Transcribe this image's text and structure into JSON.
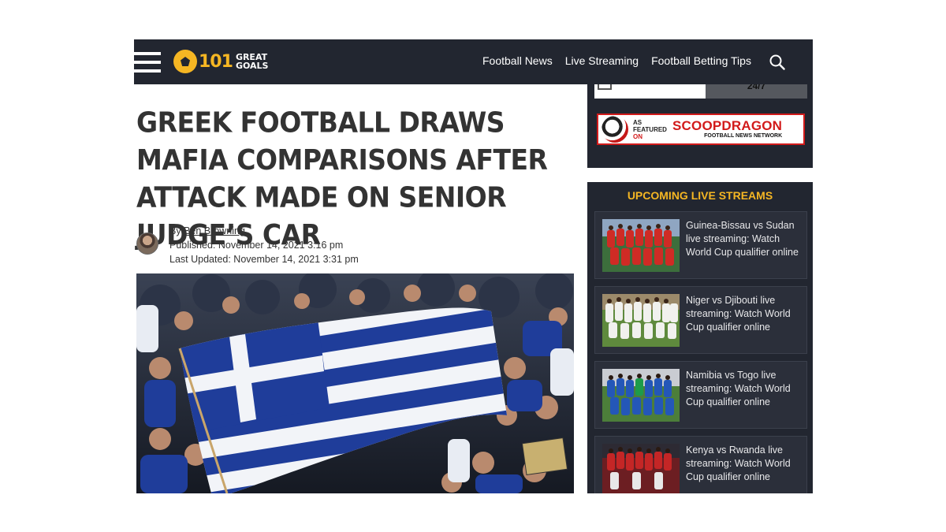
{
  "header": {
    "logo": {
      "number": "101",
      "word1": "GREAT",
      "word2": "GOALS"
    },
    "nav": [
      "Football News",
      "Live Streaming",
      "Football Betting Tips"
    ]
  },
  "sidebar": {
    "ad_text": "24/7",
    "scoop": {
      "as": "AS",
      "featured": "FEATURED",
      "on": "ON",
      "name": "SCOOPDRAGON",
      "network": "FOOTBALL NEWS NETWORK"
    },
    "streams_title": "UPCOMING LIVE STREAMS",
    "streams": [
      {
        "title": "Guinea-Bissau vs Sudan live streaming: Watch World Cup qualifier online"
      },
      {
        "title": "Niger vs Djibouti live streaming: Watch World Cup qualifier online"
      },
      {
        "title": "Namibia vs Togo live streaming: Watch World Cup qualifier online"
      },
      {
        "title": "Kenya vs Rwanda live streaming: Watch World Cup qualifier online"
      }
    ]
  },
  "article": {
    "headline": "Greek football draws mafia comparisons after attack made on senior judge’s car",
    "by": "By",
    "author": "Ben Browning",
    "published": "Published: November 14, 2021 3:16 pm",
    "updated": "Last Updated: November 14, 2021 3:31 pm"
  },
  "colors": {
    "header_bg": "#222630",
    "accent": "#f5b623",
    "scoop_red": "#d21a1a",
    "greek_blue": "#1f3d9a"
  }
}
